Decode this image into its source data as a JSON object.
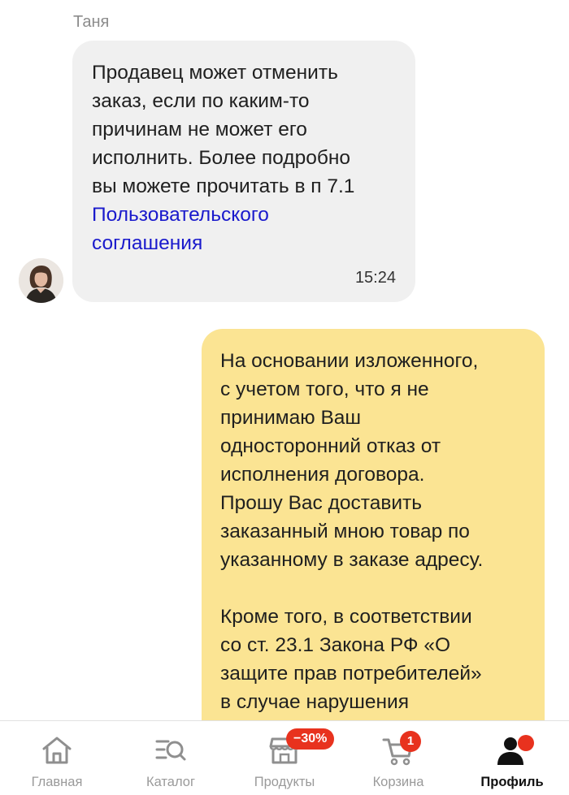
{
  "chat": {
    "incoming": {
      "sender": "Таня",
      "lines": [
        "Продавец может отменить",
        "заказ, если по каким-то",
        "причинам не может его",
        "исполнить. Более подробно",
        "вы можете прочитать в п 7.1"
      ],
      "link_lines": [
        "Пользовательского",
        "соглашения"
      ],
      "time": "15:24"
    },
    "outgoing": {
      "paragraph1": [
        "На основании изложенного,",
        "с учетом того, что я не",
        "принимаю Ваш",
        "односторонний отказ от",
        "исполнения договора.",
        "Прошу Вас доставить",
        "заказанный мною товар по",
        "указанному в заказе адресу."
      ],
      "paragraph2": [
        "Кроме того, в соответствии",
        "со ст. 23.1 Закона РФ «О",
        "защите прав потребителей»",
        "в случае нарушения"
      ]
    }
  },
  "tabbar": {
    "tabs": [
      {
        "label": "Главная",
        "icon": "home-icon"
      },
      {
        "label": "Каталог",
        "icon": "catalog-search-icon"
      },
      {
        "label": "Продукты",
        "icon": "shop-icon",
        "badge": "−30%"
      },
      {
        "label": "Корзина",
        "icon": "cart-icon",
        "badge": "1"
      },
      {
        "label": "Профиль",
        "icon": "profile-icon",
        "active": true
      }
    ]
  },
  "colors": {
    "incoming_bubble": "#f0f0f0",
    "outgoing_bubble": "#fbe493",
    "link": "#1a1acc",
    "badge": "#e8321e"
  }
}
